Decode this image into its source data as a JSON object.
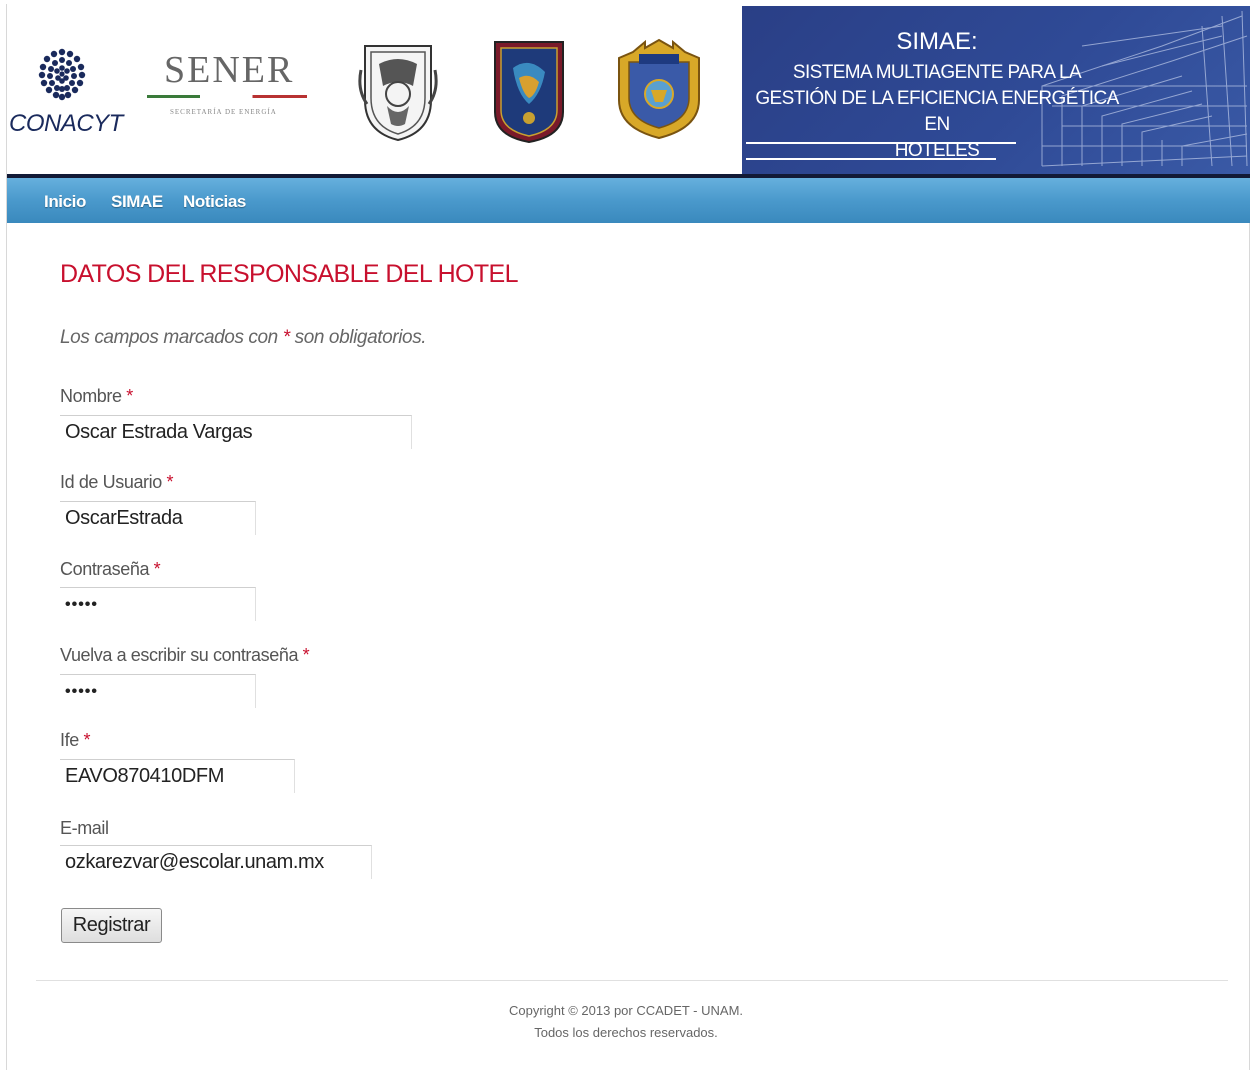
{
  "header": {
    "conacyt_label": "CONACYT",
    "sener_label": "SENER",
    "sener_sub": "SECRETARÍA DE ENERGÍA",
    "banner_title": "SIMAE:",
    "banner_subtitle_lines": [
      "SISTEMA MULTIAGENTE PARA LA",
      "GESTIÓN DE LA EFICIENCIA ENERGÉTICA EN",
      "HOTELES"
    ],
    "banner_color": "#2f4a96"
  },
  "nav": {
    "items": [
      {
        "label": "Inicio"
      },
      {
        "label": "SIMAE"
      },
      {
        "label": "Noticias"
      }
    ],
    "color": "#4a99cc"
  },
  "form": {
    "title": "DATOS DEL RESPONSABLE DEL HOTEL",
    "note_before": "Los campos marcados con ",
    "note_star": "*",
    "note_after": " son obligatorios.",
    "fields": [
      {
        "label": "Nombre",
        "required": "*",
        "value": "Oscar Estrada Vargas"
      },
      {
        "label": "Id de Usuario",
        "required": "*",
        "value": "OscarEstrada"
      },
      {
        "label": "Contraseña",
        "required": "*",
        "value": "•••••"
      },
      {
        "label": "Vuelva a escribir su contraseña",
        "required": "*",
        "value": "•••••"
      },
      {
        "label": "Ife",
        "required": "*",
        "value": "EAVO870410DFM"
      },
      {
        "label": "E-mail",
        "required": "",
        "value": "ozkarezvar@escolar.unam.mx"
      }
    ],
    "submit_label": "Registrar",
    "accent_color": "#c8102e"
  },
  "footer": {
    "line1": "Copyright © 2013 por CCADET - UNAM.",
    "line2": "Todos los derechos reservados."
  }
}
